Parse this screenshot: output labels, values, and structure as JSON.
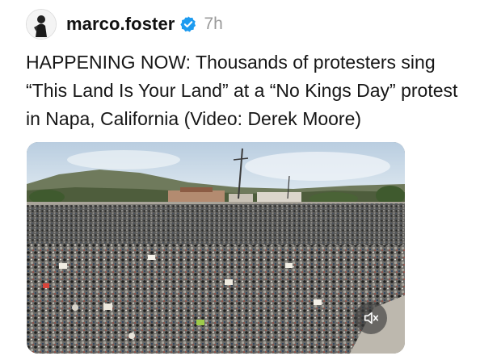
{
  "post": {
    "username": "marco.foster",
    "time": "7h",
    "caption": "HAPPENING NOW: Thousands of protesters sing “This Land Is Your Land” at a “No Kings Day” protest in Napa, California (Video: Derek Moore)",
    "verified": true
  },
  "icons": {
    "avatar": "avatar-image",
    "verified": "verified-badge-icon",
    "mute": "speaker-muted-icon"
  },
  "colors": {
    "verified_blue": "#1d9bf0",
    "time_gray": "#9a9a9a"
  }
}
